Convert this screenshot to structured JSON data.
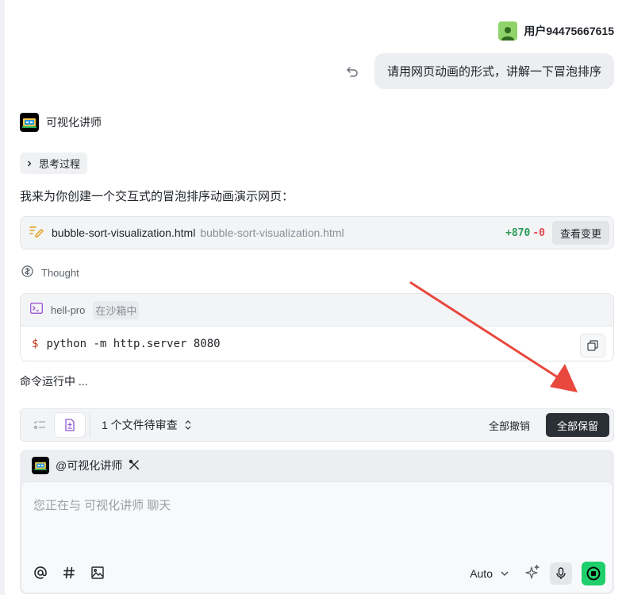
{
  "user": {
    "name": "用户94475667615",
    "message": "请用网页动画的形式，讲解一下冒泡排序"
  },
  "assistant": {
    "name": "可视化讲师",
    "thinking_label": "思考过程",
    "intro": "我来为你创建一个交互式的冒泡排序动画演示网页：",
    "file": {
      "name": "bubble-sort-visualization.html",
      "path": "bubble-sort-visualization.html",
      "additions": "+870",
      "deletions": "-0",
      "view_label": "查看变更"
    },
    "thought_label": "Thought",
    "terminal": {
      "name": "hell-pro",
      "badge": "在沙箱中",
      "prompt": "$",
      "command": "python -m http.server 8080"
    },
    "status": "命令运行中 ..."
  },
  "review": {
    "pending": "1 个文件待审查",
    "undo_all": "全部撤销",
    "keep_all": "全部保留"
  },
  "composer": {
    "mention": "@可视化讲师",
    "placeholder": "您正在与 可视化讲师 聊天",
    "model": "Auto"
  },
  "colors": {
    "accent_green": "#1fcf6b",
    "diff_add": "#2b9a5b",
    "diff_del": "#e5484d",
    "arrow": "#e8483d"
  }
}
